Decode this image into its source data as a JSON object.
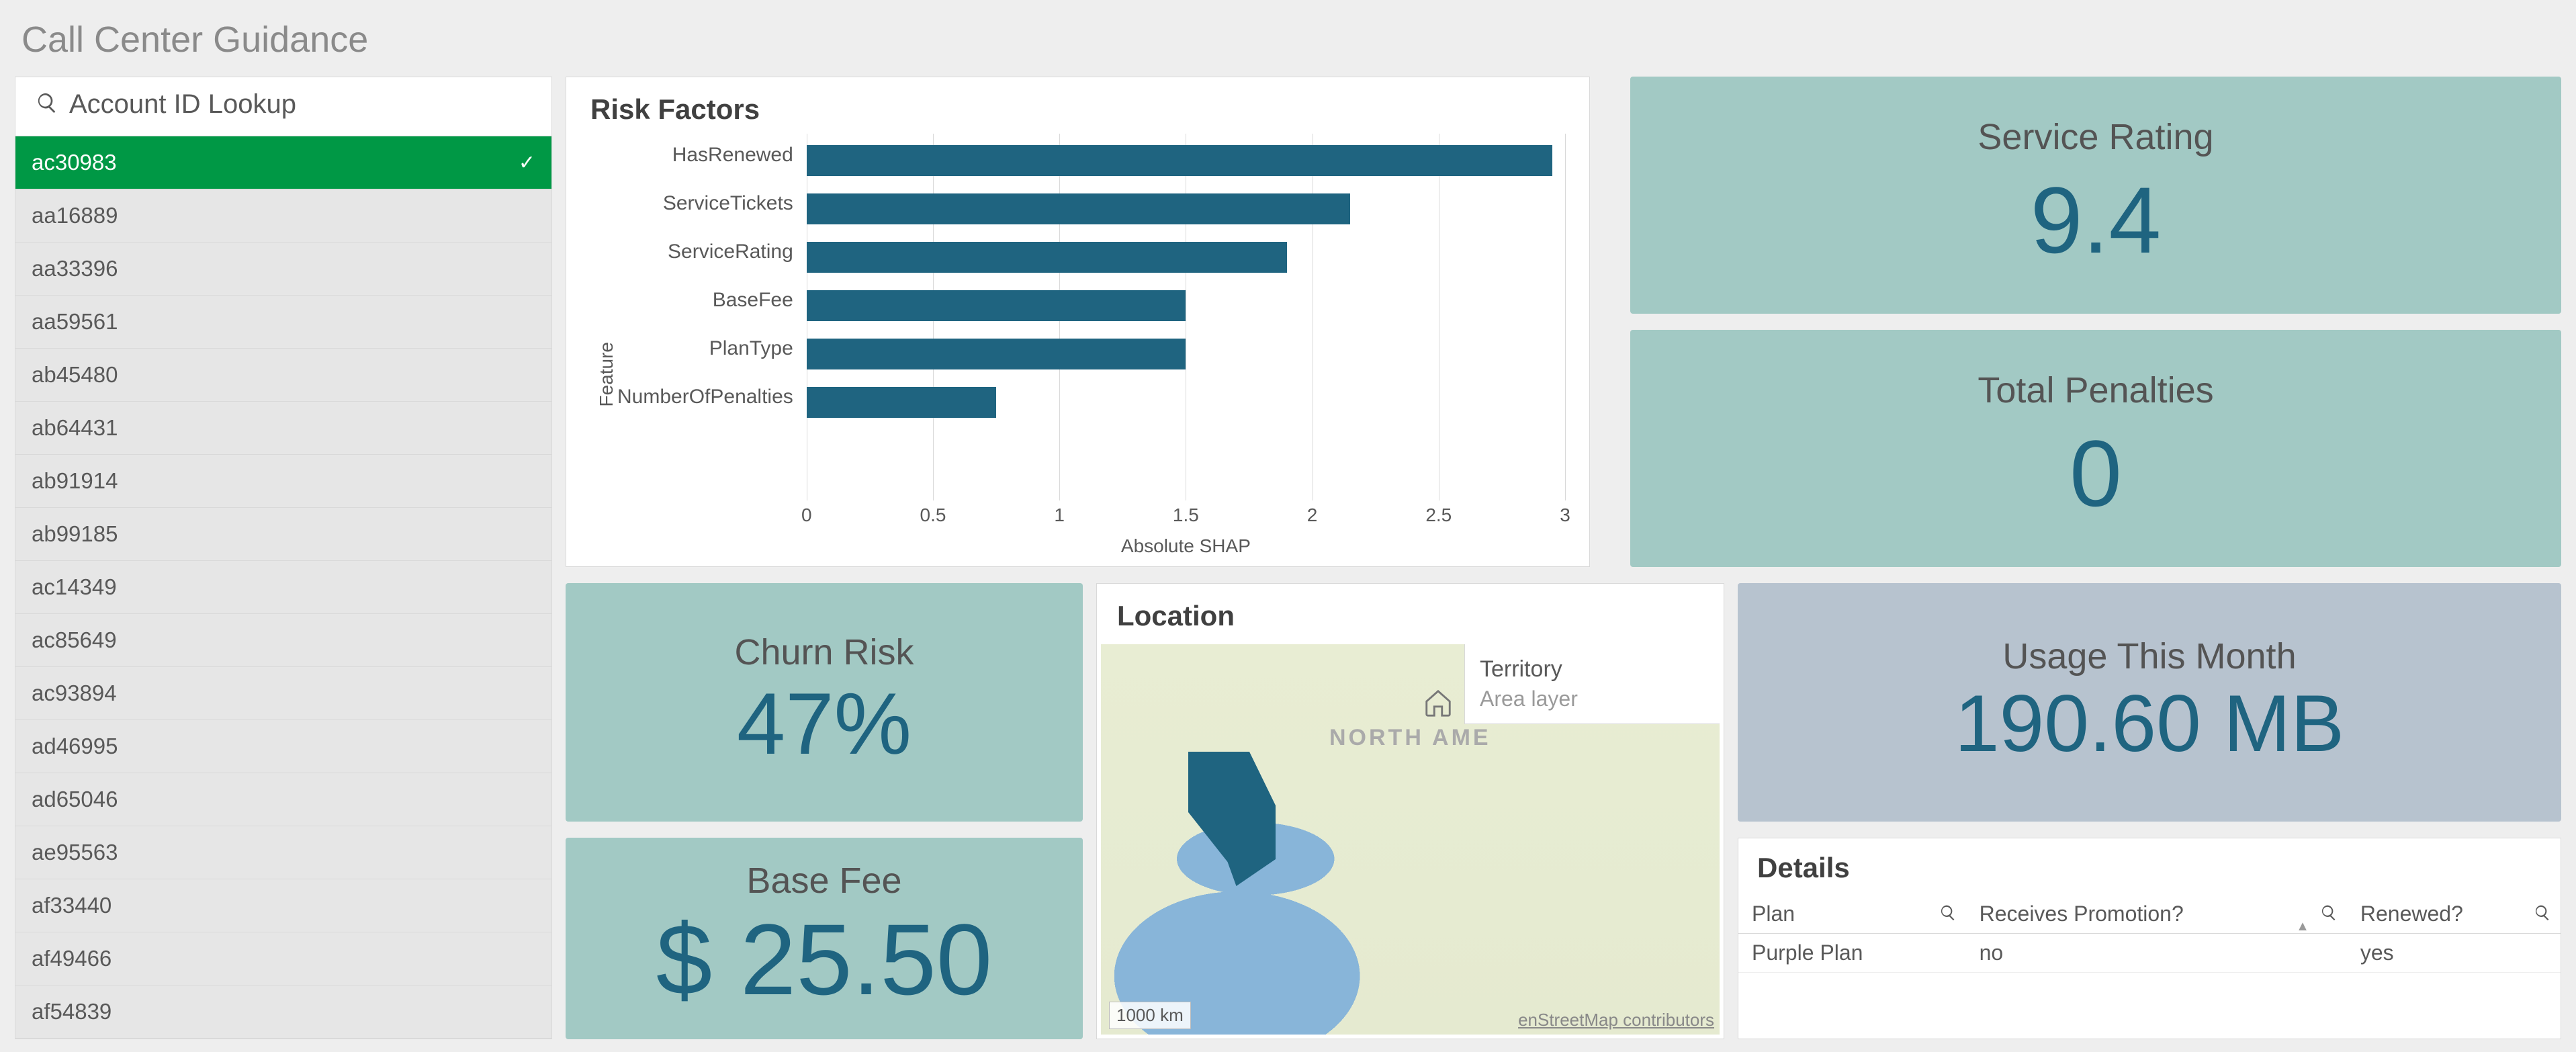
{
  "page_title": "Call Center Guidance",
  "lookup": {
    "label": "Account ID Lookup"
  },
  "accounts": {
    "selected_index": 0,
    "items": [
      "ac30983",
      "aa16889",
      "aa33396",
      "aa59561",
      "ab45480",
      "ab64431",
      "ab91914",
      "ab99185",
      "ac14349",
      "ac85649",
      "ac93894",
      "ad46995",
      "ad65046",
      "ae95563",
      "af33440",
      "af49466",
      "af54839"
    ]
  },
  "risk_factors": {
    "title": "Risk Factors"
  },
  "chart_data": {
    "type": "bar",
    "orientation": "horizontal",
    "ylabel": "Feature",
    "xlabel": "Absolute SHAP",
    "xlim": [
      0,
      3
    ],
    "xticks": [
      0,
      0.5,
      1,
      1.5,
      2,
      2.5,
      3
    ],
    "categories": [
      "HasRenewed",
      "ServiceTickets",
      "ServiceRating",
      "BaseFee",
      "PlanType",
      "NumberOfPenalties"
    ],
    "values": [
      2.95,
      2.15,
      1.9,
      1.5,
      1.5,
      0.75
    ],
    "bar_color": "#1f6480"
  },
  "kpis": {
    "service_rating": {
      "title": "Service Rating",
      "value": "9.4"
    },
    "total_penalties": {
      "title": "Total Penalties",
      "value": "0"
    },
    "churn_risk": {
      "title": "Churn Risk",
      "value": "47%"
    },
    "base_fee": {
      "title": "Base Fee",
      "value": "$ 25.50"
    },
    "usage": {
      "title": "Usage This Month",
      "value": "190.60 MB"
    }
  },
  "map": {
    "title": "Location",
    "label": "NORTH AME",
    "legend_title": "Territory",
    "legend_sub": "Area layer",
    "scale": "1000 km",
    "attribution": "enStreetMap contributors"
  },
  "details": {
    "title": "Details",
    "columns": [
      "Plan",
      "Receives Promotion?",
      "Renewed?"
    ],
    "rows": [
      {
        "plan": "Purple Plan",
        "promo": "no",
        "renewed": "yes"
      }
    ]
  }
}
